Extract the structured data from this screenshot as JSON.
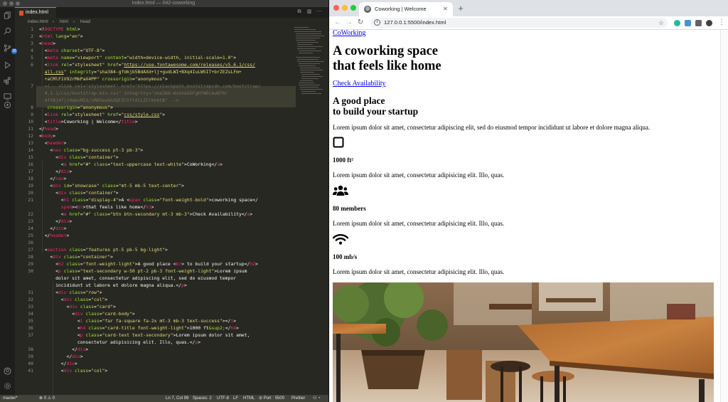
{
  "vscode": {
    "window_title": "index.html — 042-coworking",
    "tab_label": "index.html",
    "breadcrumbs": [
      "index.html",
      "html",
      "head"
    ],
    "code_lines": [
      {
        "n": "1",
        "html": "<span class='p'>&lt;!</span><span class='t'>DOCTYPE</span> <span class='a'>html</span><span class='p'>&gt;</span>"
      },
      {
        "n": "2",
        "html": "<span class='p'>&lt;</span><span class='t'>html</span> <span class='a'>lang</span>=<span class='s'>\"en\"</span><span class='p'>&gt;</span>"
      },
      {
        "n": "3",
        "html": "<span class='p'>&lt;</span><span class='t'>head</span><span class='p'>&gt;</span>"
      },
      {
        "n": "4",
        "html": "  <span class='p'>&lt;</span><span class='t'>meta</span> <span class='a'>charset</span>=<span class='s'>\"UTF-8\"</span><span class='p'>&gt;</span>"
      },
      {
        "n": "5",
        "html": "  <span class='p'>&lt;</span><span class='t'>meta</span> <span class='a'>name</span>=<span class='s'>\"viewport\"</span> <span class='a'>content</span>=<span class='s'>\"width=device-width, initial-scale=1.0\"</span><span class='p'>&gt;</span>"
      },
      {
        "n": "6",
        "html": "  <span class='p'>&lt;</span><span class='t'>link</span> <span class='a'>rel</span>=<span class='s'>\"stylesheet\"</span> <span class='a'>href</span>=<span class='s'>\"</span><span class='u'>https://use.fontawesome.com/releases/v5.6.1/css/</span>"
      },
      {
        "n": "",
        "html": "  <span class='u'>all.css</span><span class='s'>\"</span> <span class='a'>integrity</span>=<span class='s'>\"sha384-gfdkjb5BdAXd+lj+gudLWI+BXq4IuLW5IT+brZEZsLFm+</span>"
      },
      {
        "n": "",
        "html": "  <span class='s'>+aCMlF1V92rMkPaX4PP\"</span> <span class='a'>crossorigin</span>=<span class='s'>\"anonymous\"</span><span class='p'>&gt;</span>"
      },
      {
        "n": "7",
        "html": "  <span class='c'>&lt;!-- &lt;link rel=\"stylesheet\" href=\"https://stackpath.bootstrapcdn.com/bootstrap/</span>"
      },
      {
        "n": "",
        "html": "  <span class='c'>4.1.1/css/bootstrap.min.css\" integrity=\"sha384-WskhaSGFgHYWDcbwN70/</span>"
      },
      {
        "n": "",
        "html": "  <span class='c'>dfYBj47jz9qbsMId/iRN3ewGhXQFZCSftd1LZCfmhktB\" --&gt;</span>"
      },
      {
        "n": "8",
        "html": "   <span class='a'>crossorigin</span>=<span class='s'>\"anonymous\"</span><span class='p'>&gt;</span>"
      },
      {
        "n": "9",
        "html": "  <span class='p'>&lt;</span><span class='t'>link</span> <span class='a'>rel</span>=<span class='s'>\"stylesheet\"</span> <span class='a'>href</span>=<span class='s'>\"</span><span class='u'>css/style.css</span><span class='s'>\"</span><span class='p'>&gt;</span>"
      },
      {
        "n": "10",
        "html": "  <span class='p'>&lt;</span><span class='t'>title</span><span class='p'>&gt;</span>Coworking | Welcome<span class='p'>&lt;/</span><span class='t'>title</span><span class='p'>&gt;</span>"
      },
      {
        "n": "11",
        "html": "<span class='p'>&lt;/</span><span class='t'>head</span><span class='p'>&gt;</span>"
      },
      {
        "n": "12",
        "html": "<span class='p'>&lt;</span><span class='t'>body</span><span class='p'>&gt;</span>"
      },
      {
        "n": "13",
        "html": "  <span class='p'>&lt;</span><span class='t'>header</span><span class='p'>&gt;</span>"
      },
      {
        "n": "14",
        "html": "    <span class='p'>&lt;</span><span class='t'>nav</span> <span class='a'>class</span>=<span class='s'>\"bg-success pt-3 pb-3\"</span><span class='p'>&gt;</span>"
      },
      {
        "n": "15",
        "html": "      <span class='p'>&lt;</span><span class='t'>div</span> <span class='a'>class</span>=<span class='s'>\"container\"</span><span class='p'>&gt;</span>"
      },
      {
        "n": "16",
        "html": "        <span class='p'>&lt;</span><span class='t'>a</span> <span class='a'>href</span>=<span class='s'>\"#\"</span> <span class='a'>class</span>=<span class='s'>\"text-uppercase text-white\"</span><span class='p'>&gt;</span>CoWorking<span class='p'>&lt;/</span><span class='t'>a</span><span class='p'>&gt;</span>"
      },
      {
        "n": "17",
        "html": "      <span class='p'>&lt;/</span><span class='t'>div</span><span class='p'>&gt;</span>"
      },
      {
        "n": "18",
        "html": "    <span class='p'>&lt;/</span><span class='t'>nav</span><span class='p'>&gt;</span>"
      },
      {
        "n": "19",
        "html": "    <span class='p'>&lt;</span><span class='t'>div</span> <span class='a'>id</span>=<span class='s'>\"showcase\"</span> <span class='a'>class</span>=<span class='s'>\"mt-5 mb-5 text-center\"</span><span class='p'>&gt;</span>"
      },
      {
        "n": "20",
        "html": "      <span class='p'>&lt;</span><span class='t'>div</span> <span class='a'>class</span>=<span class='s'>\"container\"</span><span class='p'>&gt;</span>"
      },
      {
        "n": "21",
        "html": "        <span class='p'>&lt;</span><span class='t'>h1</span> <span class='a'>class</span>=<span class='s'>\"display-4\"</span><span class='p'>&gt;</span>A <span class='p'>&lt;</span><span class='t'>span</span> <span class='a'>class</span>=<span class='s'>\"font-weight-bold\"</span><span class='p'>&gt;</span>coworking space<span class='p'>&lt;/</span>"
      },
      {
        "n": "",
        "html": "        <span class='t'>span</span><span class='p'>&gt;&lt;</span><span class='t'>br</span><span class='p'>&gt;</span>that feels like home<span class='p'>&lt;/</span><span class='t'>h1</span><span class='p'>&gt;</span>"
      },
      {
        "n": "22",
        "html": "        <span class='p'>&lt;</span><span class='t'>a</span> <span class='a'>href</span>=<span class='s'>\"#\"</span> <span class='a'>class</span>=<span class='s'>\"btn btn-secondary mt-3 mb-3\"</span><span class='p'>&gt;</span>Check Availability<span class='p'>&lt;/</span><span class='t'>a</span><span class='p'>&gt;</span>"
      },
      {
        "n": "23",
        "html": "      <span class='p'>&lt;/</span><span class='t'>div</span><span class='p'>&gt;</span>"
      },
      {
        "n": "24",
        "html": "    <span class='p'>&lt;/</span><span class='t'>div</span><span class='p'>&gt;</span>"
      },
      {
        "n": "25",
        "html": "  <span class='p'>&lt;/</span><span class='t'>header</span><span class='p'>&gt;</span>"
      },
      {
        "n": "26",
        "html": ""
      },
      {
        "n": "27",
        "html": "  <span class='p'>&lt;</span><span class='t'>section</span> <span class='a'>class</span>=<span class='s'>\"features pt-5 pb-5 bg-light\"</span><span class='p'>&gt;</span>"
      },
      {
        "n": "28",
        "html": "    <span class='p'>&lt;</span><span class='t'>div</span> <span class='a'>class</span>=<span class='s'>\"container\"</span><span class='p'>&gt;</span>"
      },
      {
        "n": "29",
        "html": "      <span class='p'>&lt;</span><span class='t'>h2</span> <span class='a'>class</span>=<span class='s'>\"font-weight-light\"</span><span class='p'>&gt;</span>A good place <span class='p'>&lt;</span><span class='t'>br</span><span class='p'>&gt;</span> to build your startup<span class='p'>&lt;/</span><span class='t'>h2</span><span class='p'>&gt;</span>"
      },
      {
        "n": "30",
        "html": "      <span class='p'>&lt;</span><span class='t'>p</span> <span class='a'>class</span>=<span class='s'>\"text-secondary w-50 pt-2 pb-3 font-weight-light\"</span><span class='p'>&gt;</span>Lorem ipsum"
      },
      {
        "n": "",
        "html": "      dolor sit amet, consectetur adipiscing elit, sed do eiusmod tempor"
      },
      {
        "n": "",
        "html": "      incididunt ut labore et dolore magna aliqua.<span class='p'>&lt;/</span><span class='t'>p</span><span class='p'>&gt;</span>"
      },
      {
        "n": "31",
        "html": "      <span class='p'>&lt;</span><span class='t'>div</span> <span class='a'>class</span>=<span class='s'>\"row\"</span><span class='p'>&gt;</span>"
      },
      {
        "n": "32",
        "html": "        <span class='p'>&lt;</span><span class='t'>div</span> <span class='a'>class</span>=<span class='s'>\"col\"</span><span class='p'>&gt;</span>"
      },
      {
        "n": "33",
        "html": "          <span class='p'>&lt;</span><span class='t'>div</span> <span class='a'>class</span>=<span class='s'>\"card\"</span><span class='p'>&gt;</span>"
      },
      {
        "n": "34",
        "html": "            <span class='p'>&lt;</span><span class='t'>div</span> <span class='a'>class</span>=<span class='s'>\"card-body\"</span><span class='p'>&gt;</span>"
      },
      {
        "n": "35",
        "html": "              <span class='p'>&lt;</span><span class='t'>i</span> <span class='a'>class</span>=<span class='s'>\"far fa-square fa-2x mt-3 mb-3 text-success\"</span><span class='p'>&gt;&lt;/</span><span class='t'>i</span><span class='p'>&gt;</span>"
      },
      {
        "n": "36",
        "html": "              <span class='p'>&lt;</span><span class='t'>h4</span> <span class='a'>class</span>=<span class='s'>\"card-title font-weight-light\"</span><span class='p'>&gt;</span>1000 ft<span class='a'>&amp;sup2;</span><span class='p'>&lt;/</span><span class='t'>h4</span><span class='p'>&gt;</span>"
      },
      {
        "n": "37",
        "html": "              <span class='p'>&lt;</span><span class='t'>p</span> <span class='a'>class</span>=<span class='s'>\"card-text text-secondary\"</span><span class='p'>&gt;</span>Lorem ipsum dolor sit amet,"
      },
      {
        "n": "",
        "html": "              consectetur adipisicing elit. Illo, quas.<span class='p'>&lt;/</span><span class='t'>p</span><span class='p'>&gt;</span>"
      },
      {
        "n": "38",
        "html": "            <span class='p'>&lt;/</span><span class='t'>div</span><span class='p'>&gt;</span>"
      },
      {
        "n": "39",
        "html": "          <span class='p'>&lt;/</span><span class='t'>div</span><span class='p'>&gt;</span>"
      },
      {
        "n": "40",
        "html": "        <span class='p'>&lt;/</span><span class='t'>div</span><span class='p'>&gt;</span>"
      },
      {
        "n": "41",
        "html": "        <span class='p'>&lt;</span><span class='t'>div</span> <span class='a'>class</span>=<span class='s'>\"col\"</span><span class='p'>&gt;</span>"
      }
    ],
    "status": {
      "branch": "master*",
      "problems": "⊗ 0 ⚠ 0",
      "cursor": "Ln 7, Col 99",
      "spaces": "Spaces: 2",
      "encoding": "UTF-8",
      "eol": "LF",
      "language": "HTML",
      "port": "⊘ Port : 5500",
      "formatter": "Prettier"
    }
  },
  "chrome": {
    "tab_title": "Coworking | Welcome",
    "url": "127.0.0.1:5500/index.html",
    "page": {
      "brand_link": "CoWorking",
      "h1_line1": "A coworking space",
      "h1_line2": "that feels like home",
      "cta_link": "Check Availability",
      "h2_line1": "A good place",
      "h2_line2": "to build your startup",
      "intro": "Lorem ipsum dolor sit amet, consectetur adipiscing elit, sed do eiusmod tempor incididunt ut labore et dolore magna aliqua.",
      "features": [
        {
          "icon": "square-icon",
          "title": "1000 ft²",
          "text": "Lorem ipsum dolor sit amet, consectetur adipisicing elit. Illo, quas."
        },
        {
          "icon": "users-icon",
          "title": "80 members",
          "text": "Lorem ipsum dolor sit amet, consectetur adipisicing elit. Illo, quas."
        },
        {
          "icon": "wifi-icon",
          "title": "100 mb/s",
          "text": "Lorem ipsum dolor sit amet, consectetur adipisicing elit. Illo, quas."
        }
      ]
    }
  }
}
